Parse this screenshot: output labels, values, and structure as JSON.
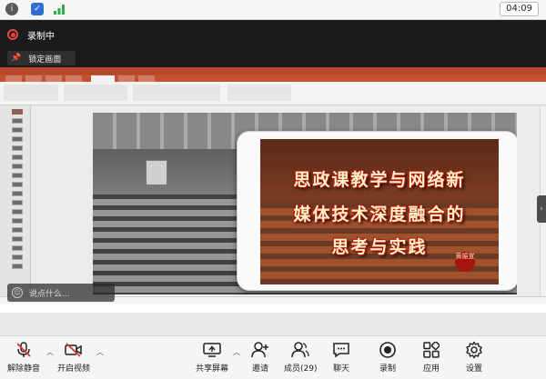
{
  "statusbar": {
    "clock": "04:09"
  },
  "meeting": {
    "recording_label": "录制中",
    "lock_screen_label": "锁定画面"
  },
  "slide": {
    "title_lines": [
      "思政课教学与网络新",
      "媒体技术深度融合的",
      "思考与实践"
    ],
    "seal_text": "黄振宣"
  },
  "chat": {
    "placeholder": "说点什么..."
  },
  "toolbar": {
    "unmute_label": "解除静音",
    "video_label": "开启视频",
    "share_label": "共享屏幕",
    "invite_label": "邀请",
    "members_label": "成员(29)",
    "chat_label": "聊天",
    "record_label": "录制",
    "apps_label": "应用",
    "settings_label": "设置"
  },
  "colors": {
    "ppt_accent": "#c4502f",
    "record_red": "#e64545",
    "headline_glow": "#c0140a"
  }
}
